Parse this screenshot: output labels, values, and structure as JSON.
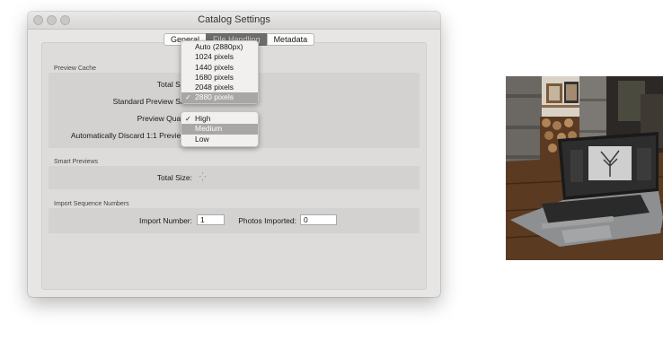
{
  "window": {
    "title": "Catalog Settings"
  },
  "tabs": [
    {
      "label": "General"
    },
    {
      "label": "File Handling"
    },
    {
      "label": "Metadata"
    }
  ],
  "preview_cache": {
    "section": "Preview Cache",
    "total_size_label": "Total Size:",
    "standard_preview_size_label": "Standard Preview Size:",
    "preview_quality_label": "Preview Quality:",
    "discard_label": "Automatically Discard 1:1 Previews:"
  },
  "size_menu": {
    "items": [
      "Auto (2880px)",
      "1024 pixels",
      "1440 pixels",
      "1680 pixels",
      "2048 pixels",
      "2880 pixels"
    ],
    "selected": "2880 pixels"
  },
  "quality_menu": {
    "items": [
      "High",
      "Medium",
      "Low"
    ],
    "checked": "High",
    "highlighted": "Medium"
  },
  "smart_previews": {
    "section": "Smart Previews",
    "total_size_label": "Total Size:"
  },
  "import_sequence": {
    "section": "Import Sequence Numbers",
    "import_number_label": "Import Number:",
    "import_number_value": "1",
    "photos_imported_label": "Photos Imported:",
    "photos_imported_value": "0"
  },
  "colors": {
    "menu_highlight": "#a7a7a7",
    "selected_tab": "#6c6c6c"
  },
  "icons": [
    "close-dot-icon",
    "minimize-dot-icon",
    "zoom-dot-icon",
    "checkmark-icon",
    "spinner-icon"
  ]
}
